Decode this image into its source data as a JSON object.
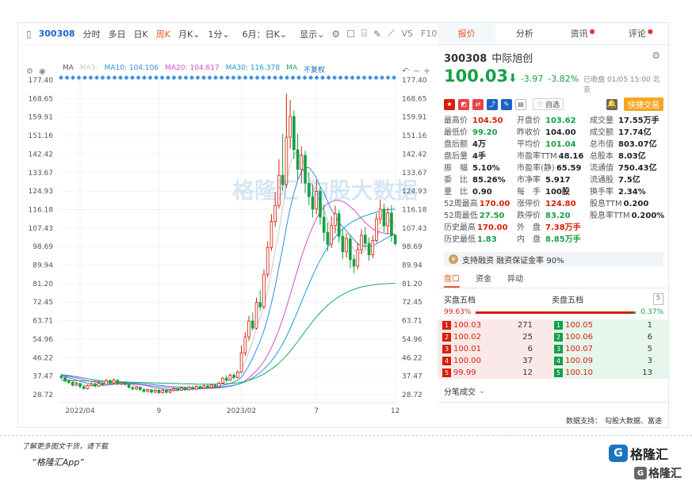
{
  "toolbar": {
    "code": "300308",
    "items": [
      "分时",
      "多日",
      "日K",
      "周K",
      "月K",
      "1分",
      "6月：日K",
      "显示"
    ],
    "active": "周K",
    "vs": "VS",
    "f10": "F10"
  },
  "ma_bar": {
    "ma": "MA",
    "ma5": "MA5:",
    "ma10": "MA10: 104.106",
    "ma20": "MA20: 104.617",
    "ma30": "MA30: 116.378",
    "ma_extra": "MA",
    "adjust": "不复权"
  },
  "watermark": "格隆汇  勾股大数据",
  "chart_data": {
    "type": "candlestick",
    "ylim": [
      28.72,
      177.4
    ],
    "yticks": [
      177.4,
      168.65,
      159.91,
      151.16,
      142.42,
      133.67,
      124.93,
      116.18,
      107.43,
      98.69,
      89.94,
      81.2,
      72.45,
      63.71,
      54.96,
      46.22,
      37.47,
      28.72
    ],
    "xticks": [
      {
        "label": "2022/04",
        "index": 5
      },
      {
        "label": "9",
        "index": 26
      },
      {
        "label": "2023/02",
        "index": 48
      },
      {
        "label": "7",
        "index": 68
      },
      {
        "label": "12",
        "index": 89
      }
    ],
    "candles": [
      [
        37.5,
        36.8,
        38.5,
        35.9
      ],
      [
        36.8,
        35.2,
        37.2,
        34.6
      ],
      [
        35.2,
        34.5,
        36.1,
        33.7
      ],
      [
        34.5,
        33.2,
        35.0,
        32.6
      ],
      [
        33.2,
        34.0,
        34.8,
        32.8
      ],
      [
        34.0,
        32.5,
        34.3,
        31.8
      ],
      [
        32.5,
        31.6,
        33.4,
        31.0
      ],
      [
        31.6,
        33.0,
        33.5,
        31.1
      ],
      [
        33.0,
        33.9,
        34.6,
        32.6
      ],
      [
        33.9,
        32.7,
        34.2,
        32.2
      ],
      [
        32.7,
        34.1,
        34.9,
        32.5
      ],
      [
        34.1,
        33.2,
        34.7,
        32.6
      ],
      [
        33.2,
        35.4,
        36.1,
        33.0
      ],
      [
        35.4,
        34.2,
        35.9,
        33.7
      ],
      [
        34.2,
        35.6,
        36.4,
        33.9
      ],
      [
        35.6,
        33.8,
        36.0,
        33.2
      ],
      [
        33.8,
        34.4,
        35.0,
        33.1
      ],
      [
        34.4,
        33.5,
        35.0,
        33.0
      ],
      [
        33.5,
        32.1,
        33.9,
        31.6
      ],
      [
        32.1,
        31.4,
        32.8,
        30.9
      ],
      [
        31.4,
        32.3,
        32.9,
        30.8
      ],
      [
        32.3,
        31.1,
        32.7,
        30.5
      ],
      [
        31.1,
        30.2,
        31.6,
        29.6
      ],
      [
        30.2,
        31.0,
        31.5,
        29.8
      ],
      [
        31.0,
        29.9,
        31.4,
        29.3
      ],
      [
        29.9,
        30.8,
        31.4,
        29.5
      ],
      [
        30.8,
        29.6,
        31.3,
        29.1
      ],
      [
        29.6,
        30.9,
        31.7,
        29.3
      ],
      [
        30.9,
        29.8,
        31.4,
        29.3
      ],
      [
        29.8,
        30.7,
        31.2,
        29.4
      ],
      [
        30.7,
        31.6,
        32.2,
        30.3
      ],
      [
        31.6,
        30.8,
        32.0,
        30.2
      ],
      [
        30.8,
        31.9,
        32.5,
        30.5
      ],
      [
        31.9,
        31.0,
        32.4,
        30.4
      ],
      [
        31.0,
        32.2,
        32.9,
        30.6
      ],
      [
        32.2,
        31.3,
        32.7,
        30.8
      ],
      [
        31.3,
        32.6,
        33.1,
        30.9
      ],
      [
        32.6,
        31.8,
        33.0,
        31.2
      ],
      [
        31.8,
        32.9,
        33.5,
        31.4
      ],
      [
        32.9,
        32.1,
        33.4,
        31.6
      ],
      [
        32.1,
        33.3,
        33.9,
        31.8
      ],
      [
        33.3,
        32.5,
        33.8,
        32.0
      ],
      [
        32.5,
        34.2,
        34.9,
        32.2
      ],
      [
        34.2,
        36.5,
        37.1,
        33.8
      ],
      [
        36.5,
        35.6,
        37.8,
        35.0
      ],
      [
        35.6,
        37.9,
        38.6,
        35.2
      ],
      [
        37.9,
        36.8,
        39.0,
        36.1
      ],
      [
        36.8,
        39.4,
        40.2,
        36.4
      ],
      [
        39.4,
        48.5,
        52.0,
        38.9
      ],
      [
        48.5,
        56.0,
        58.2,
        47.0
      ],
      [
        56.0,
        63.5,
        66.0,
        54.2
      ],
      [
        63.5,
        60.1,
        67.5,
        58.9
      ],
      [
        60.1,
        72.3,
        74.6,
        59.5
      ],
      [
        72.3,
        70.2,
        78.0,
        68.5
      ],
      [
        70.2,
        85.6,
        88.0,
        69.3
      ],
      [
        85.6,
        98.3,
        101.2,
        84.1
      ],
      [
        98.3,
        110.5,
        114.0,
        96.8
      ],
      [
        110.5,
        118.2,
        124.5,
        108.0
      ],
      [
        118.2,
        132.4,
        140.0,
        116.6
      ],
      [
        132.4,
        128.0,
        152.0,
        125.0
      ],
      [
        128.0,
        150.4,
        171.0,
        126.5
      ],
      [
        150.4,
        160.2,
        168.0,
        145.0
      ],
      [
        160.2,
        144.5,
        163.0,
        140.2
      ],
      [
        144.5,
        135.2,
        152.0,
        130.4
      ],
      [
        135.2,
        141.8,
        146.0,
        128.5
      ],
      [
        141.8,
        128.6,
        144.0,
        124.0
      ],
      [
        128.6,
        122.3,
        134.0,
        118.2
      ],
      [
        122.3,
        116.4,
        128.0,
        112.5
      ],
      [
        116.4,
        124.8,
        130.2,
        114.0
      ],
      [
        124.8,
        112.6,
        127.0,
        109.0
      ],
      [
        112.6,
        105.4,
        118.5,
        101.2
      ],
      [
        105.4,
        99.8,
        110.0,
        96.5
      ],
      [
        99.8,
        108.6,
        113.0,
        98.0
      ],
      [
        108.6,
        114.2,
        118.0,
        105.0
      ],
      [
        114.2,
        103.5,
        116.0,
        100.4
      ],
      [
        103.5,
        96.2,
        107.0,
        92.8
      ],
      [
        96.2,
        102.4,
        105.0,
        93.5
      ],
      [
        102.4,
        92.6,
        104.5,
        88.4
      ],
      [
        92.6,
        89.4,
        95.0,
        86.2
      ],
      [
        89.4,
        97.3,
        100.5,
        88.0
      ],
      [
        97.3,
        104.1,
        106.8,
        95.0
      ],
      [
        104.1,
        100.2,
        108.0,
        97.6
      ],
      [
        100.2,
        94.8,
        103.0,
        92.0
      ],
      [
        94.8,
        101.6,
        104.0,
        93.2
      ],
      [
        101.6,
        111.8,
        114.5,
        100.5
      ],
      [
        111.8,
        116.4,
        121.0,
        109.3
      ],
      [
        116.4,
        108.5,
        119.0,
        105.6
      ],
      [
        108.5,
        114.6,
        117.2,
        104.5
      ],
      [
        114.6,
        104.0,
        118.2,
        101.0
      ],
      [
        104.0,
        100.03,
        104.5,
        99.2
      ]
    ],
    "series": [
      {
        "name": "MA5",
        "color": "#c8c8c8",
        "values": [
          37.2,
          36.5,
          35.8,
          35.0,
          34.3,
          33.8,
          33.2,
          32.9,
          33.0,
          33.1,
          33.2,
          33.4,
          33.7,
          34.1,
          34.6,
          34.5,
          34.4,
          34.3,
          33.9,
          33.2,
          32.7,
          32.1,
          31.6,
          31.2,
          30.9,
          30.6,
          30.5,
          30.4,
          30.4,
          30.4,
          30.6,
          30.8,
          31.2,
          31.4,
          31.6,
          31.5,
          31.7,
          32.0,
          32.3,
          32.4,
          32.6,
          32.8,
          33.2,
          34.0,
          35.0,
          35.8,
          37.0,
          37.8,
          40.0,
          44.6,
          49.0,
          54.0,
          60.0,
          65.0,
          71.0,
          78.0,
          87.0,
          97.0,
          106.0,
          117.0,
          128.0,
          138.0,
          142.0,
          144.0,
          141.0,
          136.0,
          131.0,
          127.0,
          123.0,
          119.0,
          116.0,
          111.0,
          108.0,
          107.0,
          106.0,
          104.0,
          102.0,
          100.0,
          97.0,
          96.0,
          96.0,
          97.0,
          98.0,
          100.0,
          103.0,
          107.0,
          109.0,
          110.0,
          112.0,
          108.0
        ]
      },
      {
        "name": "MA10",
        "color": "#2f8fe0",
        "values": [
          37.8,
          37.3,
          36.8,
          36.2,
          35.6,
          35.0,
          34.5,
          34.1,
          33.7,
          33.4,
          33.3,
          33.3,
          33.3,
          33.4,
          33.6,
          33.8,
          34.0,
          34.1,
          34.1,
          34.0,
          33.8,
          33.5,
          33.2,
          32.8,
          32.4,
          32.0,
          31.7,
          31.4,
          31.2,
          31.1,
          31.0,
          31.0,
          31.1,
          31.2,
          31.3,
          31.4,
          31.5,
          31.7,
          31.9,
          32.0,
          32.1,
          32.3,
          32.6,
          33.0,
          33.5,
          34.0,
          34.7,
          35.5,
          37.0,
          39.5,
          42.5,
          46.0,
          50.0,
          54.0,
          59.0,
          65.0,
          72.0,
          80.0,
          89.0,
          98.0,
          108.0,
          117.0,
          124.0,
          130.0,
          134.0,
          136.0,
          136.0,
          134.0,
          131.0,
          127.0,
          124.0,
          120.0,
          116.0,
          113.0,
          110.0,
          108.0,
          106.0,
          104.0,
          102.0,
          100.0,
          99.0,
          99.0,
          99.0,
          99.0,
          100.0,
          101.0,
          102.0,
          103.0,
          104.0,
          104.1
        ]
      },
      {
        "name": "MA20",
        "color": "#d24fc8",
        "values": [
          38.0,
          37.7,
          37.4,
          37.0,
          36.6,
          36.2,
          35.8,
          35.4,
          35.0,
          34.7,
          34.4,
          34.2,
          34.0,
          33.9,
          33.8,
          33.8,
          33.8,
          33.8,
          33.8,
          33.7,
          33.6,
          33.5,
          33.3,
          33.1,
          32.9,
          32.7,
          32.5,
          32.3,
          32.1,
          31.9,
          31.8,
          31.7,
          31.6,
          31.6,
          31.5,
          31.5,
          31.5,
          31.5,
          31.6,
          31.6,
          31.7,
          31.8,
          31.9,
          32.1,
          32.4,
          32.7,
          33.1,
          33.5,
          34.2,
          35.3,
          36.7,
          38.3,
          40.0,
          42.0,
          44.5,
          47.5,
          51.0,
          55.0,
          59.5,
          64.5,
          70.0,
          76.0,
          82.0,
          88.0,
          94.0,
          99.0,
          104.0,
          108.0,
          112.0,
          115.0,
          117.5,
          119.0,
          120.0,
          120.5,
          120.5,
          120.0,
          119.0,
          117.5,
          116.0,
          114.0,
          112.0,
          110.0,
          108.5,
          107.0,
          106.0,
          105.5,
          105.0,
          104.8,
          104.7,
          104.617
        ]
      },
      {
        "name": "MA30",
        "color": "#1e9ad6",
        "values": [
          38.2,
          38.0,
          37.8,
          37.5,
          37.2,
          36.9,
          36.6,
          36.3,
          36.0,
          35.7,
          35.4,
          35.2,
          35.0,
          34.8,
          34.7,
          34.6,
          34.5,
          34.4,
          34.3,
          34.2,
          34.1,
          34.0,
          33.9,
          33.8,
          33.6,
          33.4,
          33.2,
          33.0,
          32.8,
          32.6,
          32.5,
          32.4,
          32.3,
          32.2,
          32.1,
          32.0,
          32.0,
          32.0,
          32.0,
          32.0,
          32.1,
          32.1,
          32.2,
          32.4,
          32.6,
          32.9,
          33.2,
          33.6,
          34.1,
          34.8,
          35.7,
          36.7,
          37.9,
          39.2,
          40.8,
          42.6,
          44.7,
          47.0,
          49.7,
          52.8,
          56.2,
          60.0,
          64.0,
          68.2,
          72.5,
          76.8,
          81.0,
          85.0,
          88.8,
          92.3,
          95.5,
          98.4,
          101.0,
          103.3,
          105.3,
          107.0,
          108.5,
          109.8,
          110.9,
          111.8,
          112.6,
          113.3,
          113.9,
          114.5,
          115.0,
          115.5,
          115.9,
          116.2,
          116.3,
          116.378
        ]
      },
      {
        "name": "MA60",
        "color": "#1aa85a",
        "values": [
          35.5,
          35.5,
          35.4,
          35.4,
          35.3,
          35.3,
          35.2,
          35.2,
          35.1,
          35.1,
          35.0,
          35.0,
          34.9,
          34.9,
          34.8,
          34.8,
          34.7,
          34.7,
          34.6,
          34.6,
          34.5,
          34.5,
          34.4,
          34.4,
          34.3,
          34.3,
          34.2,
          34.2,
          34.1,
          34.1,
          34.0,
          34.0,
          33.9,
          33.9,
          33.8,
          33.8,
          33.7,
          33.7,
          33.7,
          33.7,
          33.7,
          33.7,
          33.8,
          33.8,
          33.9,
          34.0,
          34.1,
          34.3,
          34.6,
          35.0,
          35.5,
          36.1,
          36.8,
          37.6,
          38.5,
          39.6,
          40.8,
          42.1,
          43.6,
          45.3,
          47.2,
          49.3,
          51.5,
          53.8,
          56.2,
          58.6,
          61.0,
          63.3,
          65.5,
          67.5,
          69.3,
          71.0,
          72.5,
          73.8,
          75.0,
          76.1,
          77.0,
          77.8,
          78.5,
          79.1,
          79.6,
          80.0,
          80.3,
          80.6,
          80.8,
          81.0,
          81.1,
          81.2,
          81.3,
          81.3
        ]
      }
    ]
  },
  "quote": {
    "tabs": [
      "报价",
      "分析",
      "资讯",
      "评论"
    ],
    "code": "300308",
    "name": "中际旭创",
    "price": "100.03",
    "change": "-3.97",
    "change_pct": "-3.82%",
    "closed_note": "已收盘 01/05 15:00 北京",
    "fav": "自选",
    "fast_trade": "快捷交易",
    "stats": [
      {
        "k": "最高价",
        "v": "104.50",
        "c": "red"
      },
      {
        "k": "开盘价",
        "v": "103.62",
        "c": "green"
      },
      {
        "k": "成交量",
        "v": "17.55万手",
        "c": "blk"
      },
      {
        "k": "最低价",
        "v": "99.20",
        "c": "green"
      },
      {
        "k": "昨收价",
        "v": "104.00",
        "c": "blk"
      },
      {
        "k": "成交额",
        "v": "17.74亿",
        "c": "blk"
      },
      {
        "k": "盘后额",
        "v": "4万",
        "c": "blk"
      },
      {
        "k": "平均价",
        "v": "101.04",
        "c": "green"
      },
      {
        "k": "总市值",
        "v": "803.07亿",
        "c": "blk"
      },
      {
        "k": "盘后量",
        "v": "4手",
        "c": "blk"
      },
      {
        "k": "市盈率TTM",
        "v": "48.16",
        "c": "blk"
      },
      {
        "k": "总股本",
        "v": "8.03亿",
        "c": "blk"
      },
      {
        "k": "振　幅",
        "v": "5.10%",
        "c": "blk"
      },
      {
        "k": "市盈率(静)",
        "v": "65.59",
        "c": "blk"
      },
      {
        "k": "流通值",
        "v": "750.43亿",
        "c": "blk"
      },
      {
        "k": "委　比",
        "v": "85.26%",
        "c": "blk"
      },
      {
        "k": "市净率",
        "v": "5.917",
        "c": "blk"
      },
      {
        "k": "流通股",
        "v": "7.5亿",
        "c": "blk"
      },
      {
        "k": "量　比",
        "v": "0.90",
        "c": "blk"
      },
      {
        "k": "每　手",
        "v": "100股",
        "c": "blk"
      },
      {
        "k": "换手率",
        "v": "2.34%",
        "c": "blk"
      },
      {
        "k": "52周最高",
        "v": "170.00",
        "c": "red"
      },
      {
        "k": "涨停价",
        "v": "124.80",
        "c": "red"
      },
      {
        "k": "股息TTM",
        "v": "0.200",
        "c": "blk"
      },
      {
        "k": "52周最低",
        "v": "27.50",
        "c": "green"
      },
      {
        "k": "跌停价",
        "v": "83.20",
        "c": "green"
      },
      {
        "k": "股息率TTM",
        "v": "0.200%",
        "c": "blk"
      },
      {
        "k": "历史最高",
        "v": "170.00",
        "c": "red"
      },
      {
        "k": "外　盘",
        "v": "7.38万手",
        "c": "red"
      },
      {
        "k": "",
        "v": "",
        "c": "blk"
      },
      {
        "k": "历史最低",
        "v": "1.83",
        "c": "green"
      },
      {
        "k": "内　盘",
        "v": "8.85万手",
        "c": "green"
      },
      {
        "k": "",
        "v": "",
        "c": "blk"
      }
    ],
    "margin": "支持融资 融资保证金率 90%",
    "subtabs": [
      "盘口",
      "资金",
      "异动"
    ],
    "bid_title": "买盘五档",
    "ask_title": "卖盘五档",
    "five": "5",
    "bid_ratio": "99.63%",
    "ask_ratio": "0.37%",
    "book": [
      {
        "bl": "1",
        "bp": "100.03",
        "bv": "271",
        "al": "1",
        "ap": "100.05",
        "av": "1"
      },
      {
        "bl": "2",
        "bp": "100.02",
        "bv": "25",
        "al": "2",
        "ap": "100.06",
        "av": "6"
      },
      {
        "bl": "3",
        "bp": "100.01",
        "bv": "6",
        "al": "3",
        "ap": "100.07",
        "av": "5"
      },
      {
        "bl": "4",
        "bp": "100.00",
        "bv": "37",
        "al": "4",
        "ap": "100.09",
        "av": "3"
      },
      {
        "bl": "5",
        "bp": "99.99",
        "bv": "12",
        "al": "5",
        "ap": "100.10",
        "av": "13"
      }
    ],
    "tick_title": "分笔成交",
    "source_label": "数据支持：",
    "source": "勾股大数据、富途"
  },
  "footer": {
    "line1": "了解更多图文干货，请下载",
    "line2": "“格隆汇App”",
    "logo": "格隆汇",
    "logo2": "格隆汇"
  },
  "colors": {
    "up": "#d81e06",
    "down": "#15a046",
    "accent": "#e25b28"
  }
}
